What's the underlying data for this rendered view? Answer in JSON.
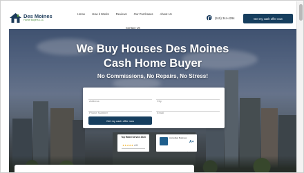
{
  "header": {
    "logo": {
      "name": "Des Moines",
      "tagline": "Home Buyers LLC",
      "icon": "house-icon"
    },
    "nav": [
      "Home",
      "How it Works",
      "Reviews",
      "Our Purchases",
      "About Us"
    ],
    "nav_second_row": "Contact Us",
    "phone": {
      "icon": "phone-icon",
      "number": "(515) 344-4294"
    },
    "cta_label": "Get my cash offer now"
  },
  "hero": {
    "title_line1": "We Buy Houses Des Moines",
    "title_line2": "Cash Home Buyer",
    "subtitle": "No Commissions, No Repairs, No Stress!"
  },
  "form": {
    "address_placeholder": "Address",
    "city_placeholder": "City",
    "phone_placeholder": "Phone Number",
    "email_placeholder": "Email",
    "submit_label": "Get my cash offer now"
  },
  "badges": {
    "award_title": "Top Rated Service 2023",
    "award_rating": "4.9",
    "bbb_label": "Accredited Business",
    "bbb_grade": "A+"
  },
  "colors": {
    "brand_navy": "#163e5e",
    "accent_green": "#4b8a3c"
  }
}
